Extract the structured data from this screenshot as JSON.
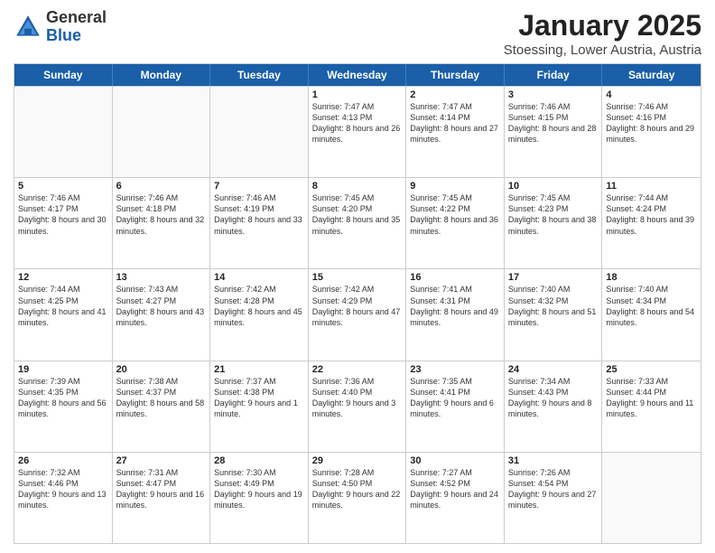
{
  "logo": {
    "general": "General",
    "blue": "Blue"
  },
  "title": "January 2025",
  "location": "Stoessing, Lower Austria, Austria",
  "header_days": [
    "Sunday",
    "Monday",
    "Tuesday",
    "Wednesday",
    "Thursday",
    "Friday",
    "Saturday"
  ],
  "weeks": [
    [
      {
        "day": "",
        "sunrise": "",
        "sunset": "",
        "daylight": "",
        "empty": true
      },
      {
        "day": "",
        "sunrise": "",
        "sunset": "",
        "daylight": "",
        "empty": true
      },
      {
        "day": "",
        "sunrise": "",
        "sunset": "",
        "daylight": "",
        "empty": true
      },
      {
        "day": "1",
        "sunrise": "Sunrise: 7:47 AM",
        "sunset": "Sunset: 4:13 PM",
        "daylight": "Daylight: 8 hours and 26 minutes."
      },
      {
        "day": "2",
        "sunrise": "Sunrise: 7:47 AM",
        "sunset": "Sunset: 4:14 PM",
        "daylight": "Daylight: 8 hours and 27 minutes."
      },
      {
        "day": "3",
        "sunrise": "Sunrise: 7:46 AM",
        "sunset": "Sunset: 4:15 PM",
        "daylight": "Daylight: 8 hours and 28 minutes."
      },
      {
        "day": "4",
        "sunrise": "Sunrise: 7:46 AM",
        "sunset": "Sunset: 4:16 PM",
        "daylight": "Daylight: 8 hours and 29 minutes."
      }
    ],
    [
      {
        "day": "5",
        "sunrise": "Sunrise: 7:46 AM",
        "sunset": "Sunset: 4:17 PM",
        "daylight": "Daylight: 8 hours and 30 minutes."
      },
      {
        "day": "6",
        "sunrise": "Sunrise: 7:46 AM",
        "sunset": "Sunset: 4:18 PM",
        "daylight": "Daylight: 8 hours and 32 minutes."
      },
      {
        "day": "7",
        "sunrise": "Sunrise: 7:46 AM",
        "sunset": "Sunset: 4:19 PM",
        "daylight": "Daylight: 8 hours and 33 minutes."
      },
      {
        "day": "8",
        "sunrise": "Sunrise: 7:45 AM",
        "sunset": "Sunset: 4:20 PM",
        "daylight": "Daylight: 8 hours and 35 minutes."
      },
      {
        "day": "9",
        "sunrise": "Sunrise: 7:45 AM",
        "sunset": "Sunset: 4:22 PM",
        "daylight": "Daylight: 8 hours and 36 minutes."
      },
      {
        "day": "10",
        "sunrise": "Sunrise: 7:45 AM",
        "sunset": "Sunset: 4:23 PM",
        "daylight": "Daylight: 8 hours and 38 minutes."
      },
      {
        "day": "11",
        "sunrise": "Sunrise: 7:44 AM",
        "sunset": "Sunset: 4:24 PM",
        "daylight": "Daylight: 8 hours and 39 minutes."
      }
    ],
    [
      {
        "day": "12",
        "sunrise": "Sunrise: 7:44 AM",
        "sunset": "Sunset: 4:25 PM",
        "daylight": "Daylight: 8 hours and 41 minutes."
      },
      {
        "day": "13",
        "sunrise": "Sunrise: 7:43 AM",
        "sunset": "Sunset: 4:27 PM",
        "daylight": "Daylight: 8 hours and 43 minutes."
      },
      {
        "day": "14",
        "sunrise": "Sunrise: 7:42 AM",
        "sunset": "Sunset: 4:28 PM",
        "daylight": "Daylight: 8 hours and 45 minutes."
      },
      {
        "day": "15",
        "sunrise": "Sunrise: 7:42 AM",
        "sunset": "Sunset: 4:29 PM",
        "daylight": "Daylight: 8 hours and 47 minutes."
      },
      {
        "day": "16",
        "sunrise": "Sunrise: 7:41 AM",
        "sunset": "Sunset: 4:31 PM",
        "daylight": "Daylight: 8 hours and 49 minutes."
      },
      {
        "day": "17",
        "sunrise": "Sunrise: 7:40 AM",
        "sunset": "Sunset: 4:32 PM",
        "daylight": "Daylight: 8 hours and 51 minutes."
      },
      {
        "day": "18",
        "sunrise": "Sunrise: 7:40 AM",
        "sunset": "Sunset: 4:34 PM",
        "daylight": "Daylight: 8 hours and 54 minutes."
      }
    ],
    [
      {
        "day": "19",
        "sunrise": "Sunrise: 7:39 AM",
        "sunset": "Sunset: 4:35 PM",
        "daylight": "Daylight: 8 hours and 56 minutes."
      },
      {
        "day": "20",
        "sunrise": "Sunrise: 7:38 AM",
        "sunset": "Sunset: 4:37 PM",
        "daylight": "Daylight: 8 hours and 58 minutes."
      },
      {
        "day": "21",
        "sunrise": "Sunrise: 7:37 AM",
        "sunset": "Sunset: 4:38 PM",
        "daylight": "Daylight: 9 hours and 1 minute."
      },
      {
        "day": "22",
        "sunrise": "Sunrise: 7:36 AM",
        "sunset": "Sunset: 4:40 PM",
        "daylight": "Daylight: 9 hours and 3 minutes."
      },
      {
        "day": "23",
        "sunrise": "Sunrise: 7:35 AM",
        "sunset": "Sunset: 4:41 PM",
        "daylight": "Daylight: 9 hours and 6 minutes."
      },
      {
        "day": "24",
        "sunrise": "Sunrise: 7:34 AM",
        "sunset": "Sunset: 4:43 PM",
        "daylight": "Daylight: 9 hours and 8 minutes."
      },
      {
        "day": "25",
        "sunrise": "Sunrise: 7:33 AM",
        "sunset": "Sunset: 4:44 PM",
        "daylight": "Daylight: 9 hours and 11 minutes."
      }
    ],
    [
      {
        "day": "26",
        "sunrise": "Sunrise: 7:32 AM",
        "sunset": "Sunset: 4:46 PM",
        "daylight": "Daylight: 9 hours and 13 minutes."
      },
      {
        "day": "27",
        "sunrise": "Sunrise: 7:31 AM",
        "sunset": "Sunset: 4:47 PM",
        "daylight": "Daylight: 9 hours and 16 minutes."
      },
      {
        "day": "28",
        "sunrise": "Sunrise: 7:30 AM",
        "sunset": "Sunset: 4:49 PM",
        "daylight": "Daylight: 9 hours and 19 minutes."
      },
      {
        "day": "29",
        "sunrise": "Sunrise: 7:28 AM",
        "sunset": "Sunset: 4:50 PM",
        "daylight": "Daylight: 9 hours and 22 minutes."
      },
      {
        "day": "30",
        "sunrise": "Sunrise: 7:27 AM",
        "sunset": "Sunset: 4:52 PM",
        "daylight": "Daylight: 9 hours and 24 minutes."
      },
      {
        "day": "31",
        "sunrise": "Sunrise: 7:26 AM",
        "sunset": "Sunset: 4:54 PM",
        "daylight": "Daylight: 9 hours and 27 minutes."
      },
      {
        "day": "",
        "sunrise": "",
        "sunset": "",
        "daylight": "",
        "empty": true
      }
    ]
  ]
}
